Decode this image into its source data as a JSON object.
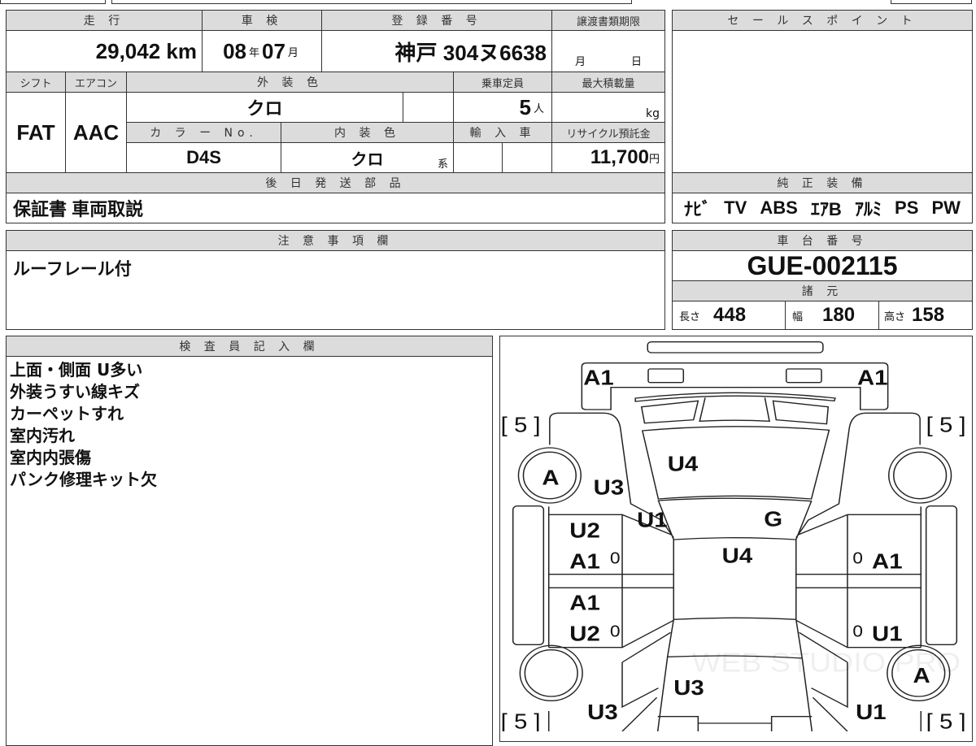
{
  "main": {
    "mileage": {
      "label": "走 行",
      "value": "29,042",
      "unit": "km"
    },
    "inspection": {
      "label": "車 検",
      "year": "08",
      "year_unit": "年",
      "month": "07",
      "month_unit": "月"
    },
    "registration": {
      "label": "登 録 番 号",
      "value": "神戸 304ヌ6638"
    },
    "transfer_deadline": {
      "label": "譲渡書類期限",
      "month_unit": "月",
      "day_unit": "日"
    },
    "shift": {
      "label": "シフト",
      "value": "FAT"
    },
    "aircon": {
      "label": "エアコン",
      "value": "AAC"
    },
    "exterior_color": {
      "label": "外 装 色",
      "value": "クロ"
    },
    "capacity": {
      "label": "乗車定員",
      "value": "5",
      "unit": "人"
    },
    "max_load": {
      "label": "最大積載量",
      "unit": "kg"
    },
    "color_no": {
      "label": "カ ラ ー No.",
      "value": "D4S"
    },
    "interior_color": {
      "label": "内 装 色",
      "value": "クロ",
      "suffix": "系"
    },
    "import": {
      "label": "輸 入 車"
    },
    "recycle": {
      "label": "リサイクル預託金",
      "value": "11,700",
      "unit": "円"
    },
    "later_parts": {
      "label": "後 日 発 送 部 品",
      "value": "保証書 車両取説"
    }
  },
  "sale_point": {
    "label": "セ ー ル ス ポ イ ン ト"
  },
  "equipment": {
    "label": "純 正 装 備",
    "items": [
      "ﾅﾋﾞ",
      "TV",
      "ABS",
      "ｴｱB",
      "ｱﾙﾐ",
      "PS",
      "PW"
    ]
  },
  "notes": {
    "label": "注 意 事 項 欄",
    "value": "ルーフレール付"
  },
  "chassis": {
    "label": "車 台 番 号",
    "value": "GUE-002115",
    "spec_label": "諸 元",
    "length_label": "長さ",
    "length": "448",
    "width_label": "幅",
    "width": "180",
    "height_label": "高さ",
    "height": "158"
  },
  "inspector": {
    "label": "検 査 員 記 入 欄",
    "lines": [
      "上面・側面 U多い",
      "外装うすい線キズ",
      "カーペットすれ",
      "室内汚れ",
      "室内内張傷",
      "パンク修理キット欠"
    ]
  },
  "diagram": {
    "labels": [
      "A1",
      "A1",
      "[ 5 ]",
      "[ 5 ]",
      "[ 5 ]",
      "[ 5 ]",
      "A",
      "U3",
      "U4",
      "U1",
      "G",
      "U2",
      "A1",
      "0",
      "U4",
      "0",
      "A1",
      "A1",
      "U2",
      "0",
      "0",
      "U1",
      "A",
      "U3",
      "U3",
      "U1"
    ],
    "watermark": "WEB STUDIO PRO"
  }
}
